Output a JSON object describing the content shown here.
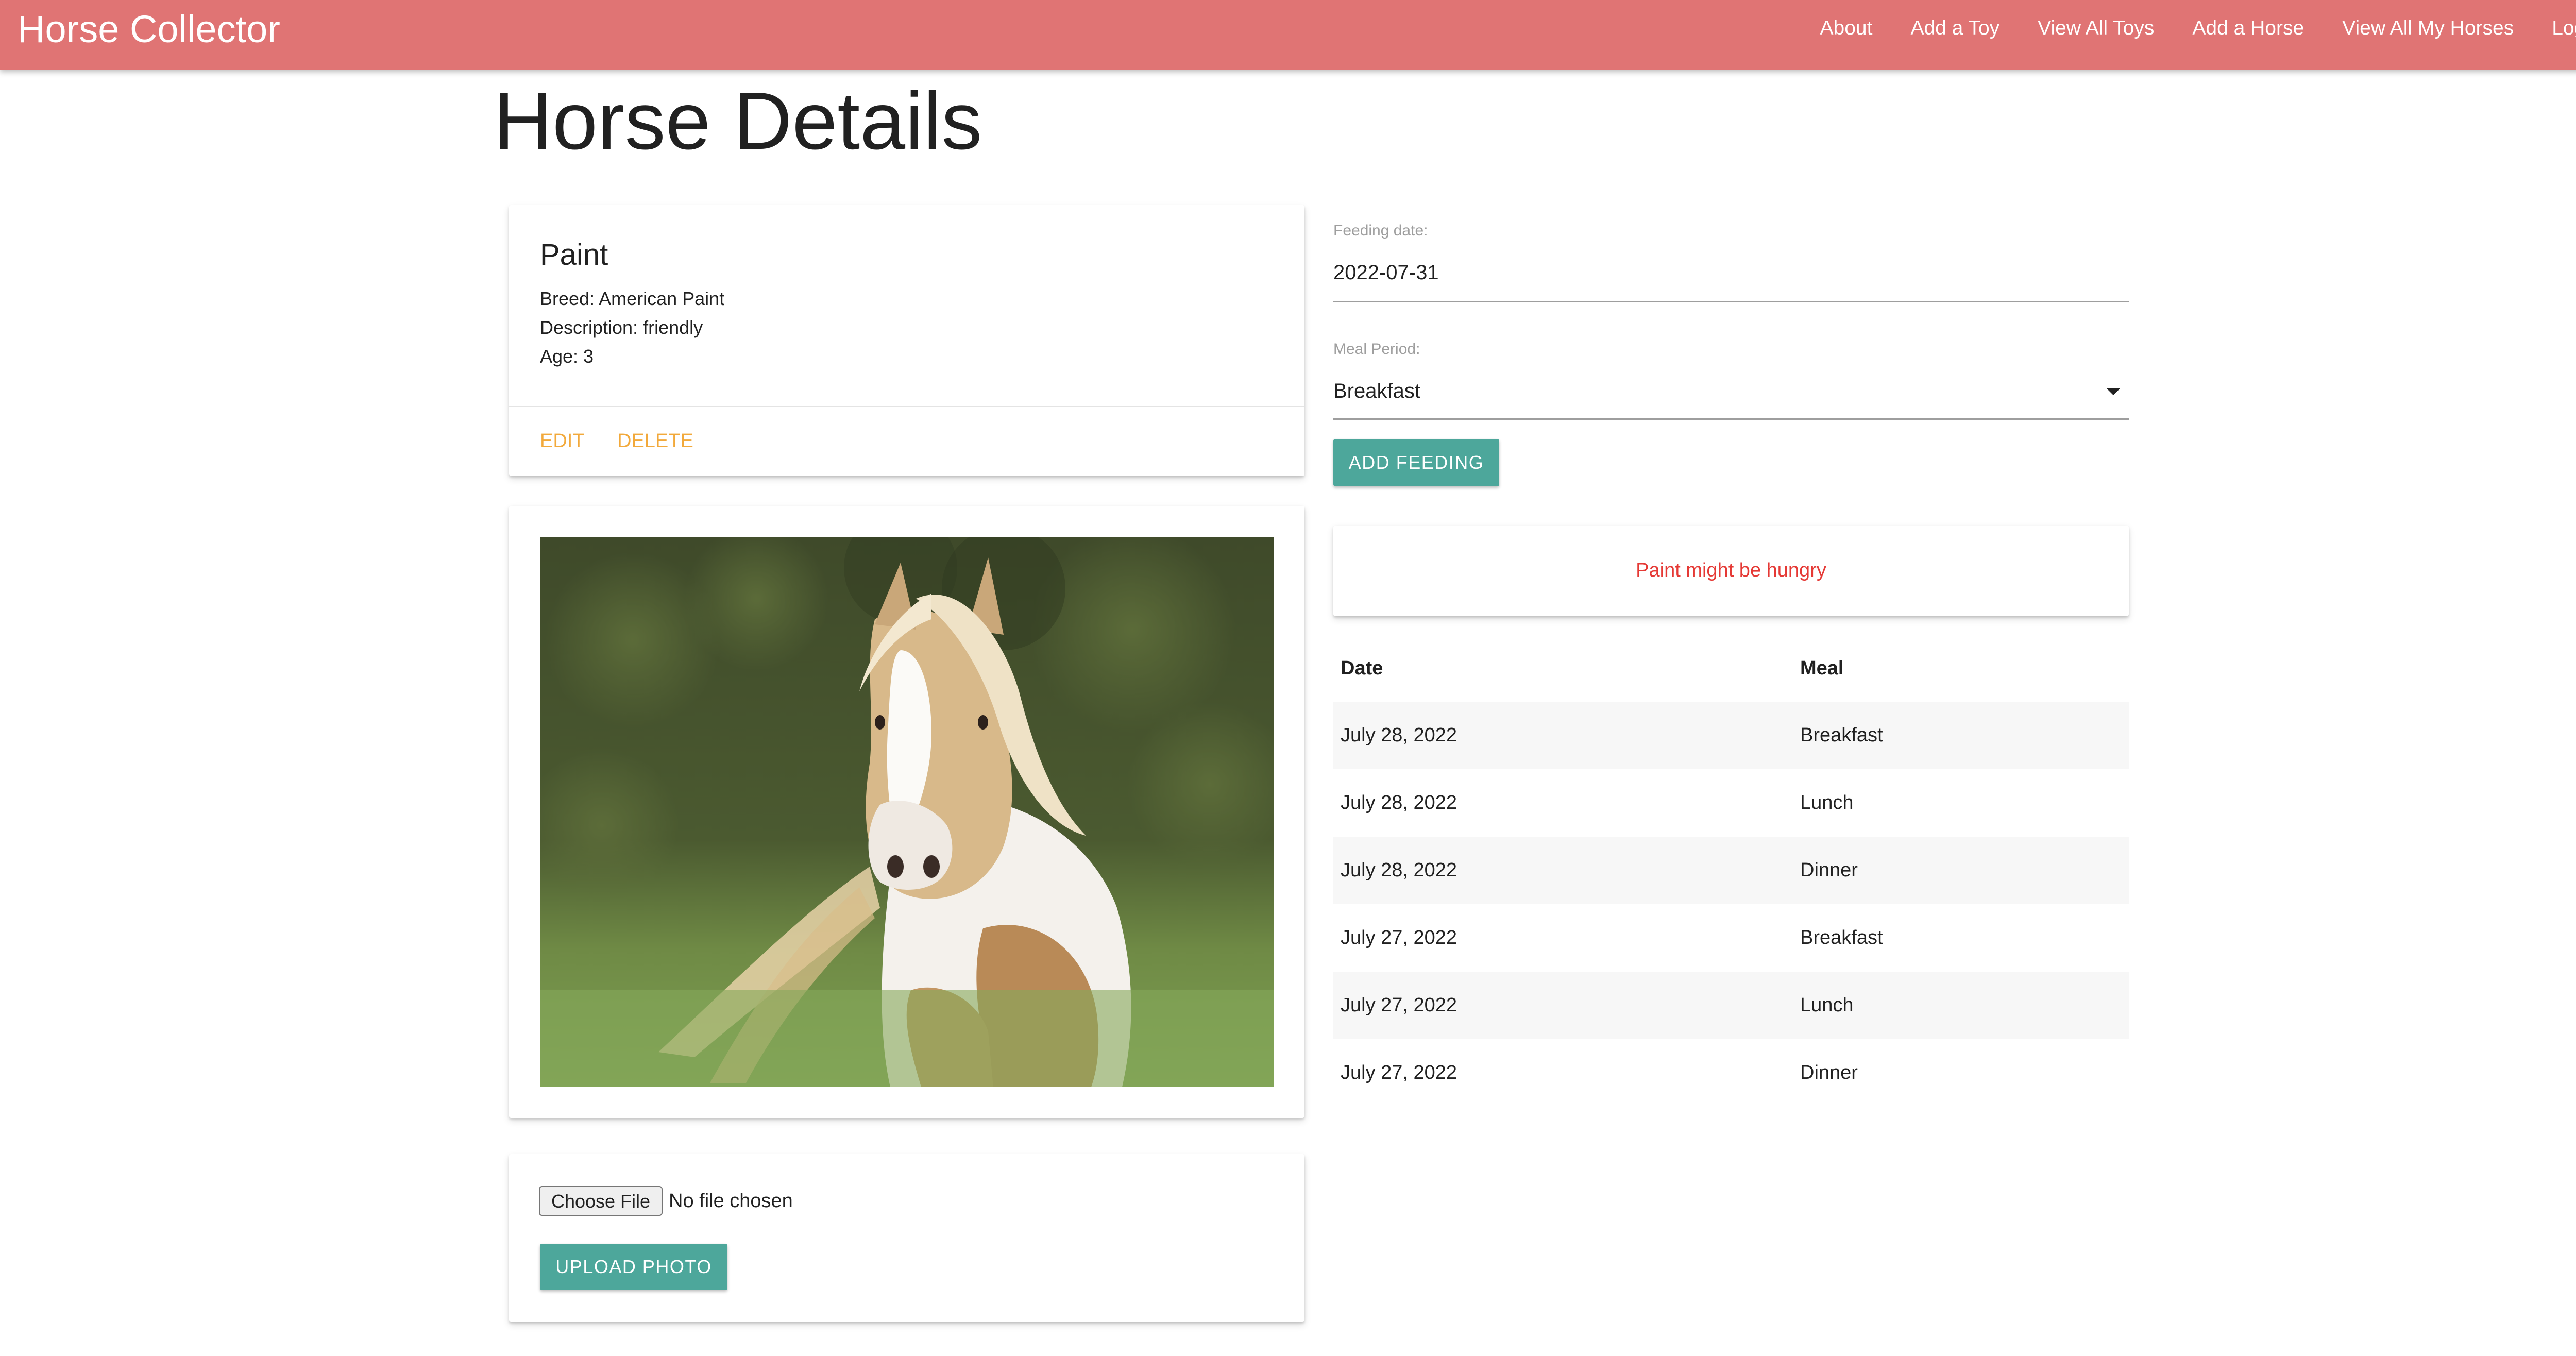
{
  "navbar": {
    "brand": "Horse Collector",
    "links": [
      "About",
      "Add a Toy",
      "View All Toys",
      "Add a Horse",
      "View All My Horses",
      "Log Out"
    ]
  },
  "page": {
    "title": "Horse Details"
  },
  "horse": {
    "name": "Paint",
    "breed_line": "Breed: American Paint",
    "description_line": "Description: friendly",
    "age_line": "Age: 3",
    "actions": {
      "edit": "EDIT",
      "delete": "DELETE"
    }
  },
  "upload": {
    "choose_file_label": "Choose File",
    "file_status": "No file chosen",
    "upload_button": "UPLOAD PHOTO"
  },
  "feeding_form": {
    "date_label": "Feeding date:",
    "date_value": "2022-07-31",
    "meal_label": "Meal Period:",
    "meal_value": "Breakfast",
    "add_button": "ADD FEEDING"
  },
  "status": {
    "message": "Paint might be hungry",
    "color": "#e53935"
  },
  "feedings_table": {
    "headers": [
      "Date",
      "Meal"
    ],
    "rows": [
      {
        "date": "July 28, 2022",
        "meal": "Breakfast"
      },
      {
        "date": "July 28, 2022",
        "meal": "Lunch"
      },
      {
        "date": "July 28, 2022",
        "meal": "Dinner"
      },
      {
        "date": "July 27, 2022",
        "meal": "Breakfast"
      },
      {
        "date": "July 27, 2022",
        "meal": "Lunch"
      },
      {
        "date": "July 27, 2022",
        "meal": "Dinner"
      }
    ]
  },
  "colors": {
    "navbar": "#e07474",
    "accent_teal": "#4da79b",
    "action_orange": "#f2a93b"
  }
}
